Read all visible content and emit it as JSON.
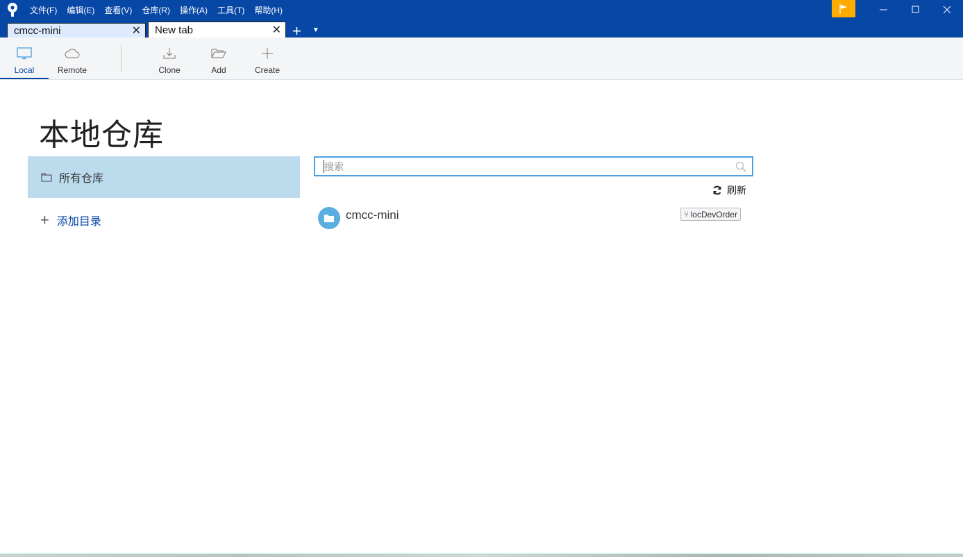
{
  "titlebar": {
    "menus": [
      "文件(F)",
      "编辑(E)",
      "查看(V)",
      "仓库(R)",
      "操作(A)",
      "工具(T)",
      "帮助(H)"
    ],
    "flag_icon": "flag-icon",
    "flag_color": "#ffab00",
    "window_controls": [
      "minimize",
      "maximize",
      "close"
    ]
  },
  "tabs": [
    {
      "label": "cmcc-mini",
      "active": false
    },
    {
      "label": "New tab",
      "active": true
    }
  ],
  "toolbar": {
    "items": [
      {
        "label": "Local",
        "icon": "monitor-icon",
        "selected": true
      },
      {
        "label": "Remote",
        "icon": "cloud-icon",
        "selected": false
      },
      {
        "label": "Clone",
        "icon": "download-icon",
        "selected": false
      },
      {
        "label": "Add",
        "icon": "folder-open-icon",
        "selected": false
      },
      {
        "label": "Create",
        "icon": "plus-icon",
        "selected": false
      }
    ]
  },
  "page": {
    "title": "本地仓库"
  },
  "sidebar": {
    "all_repos": "所有仓库",
    "add_directory": "添加目录"
  },
  "search": {
    "placeholder": "搜索",
    "value": ""
  },
  "refresh_label": "刷新",
  "repositories": [
    {
      "name": "cmcc-mini",
      "branch": "locDevOrder"
    }
  ],
  "colors": {
    "accent": "#0747a6",
    "selected_bg": "#bcdcee",
    "repo_icon": "#5aaee0"
  }
}
